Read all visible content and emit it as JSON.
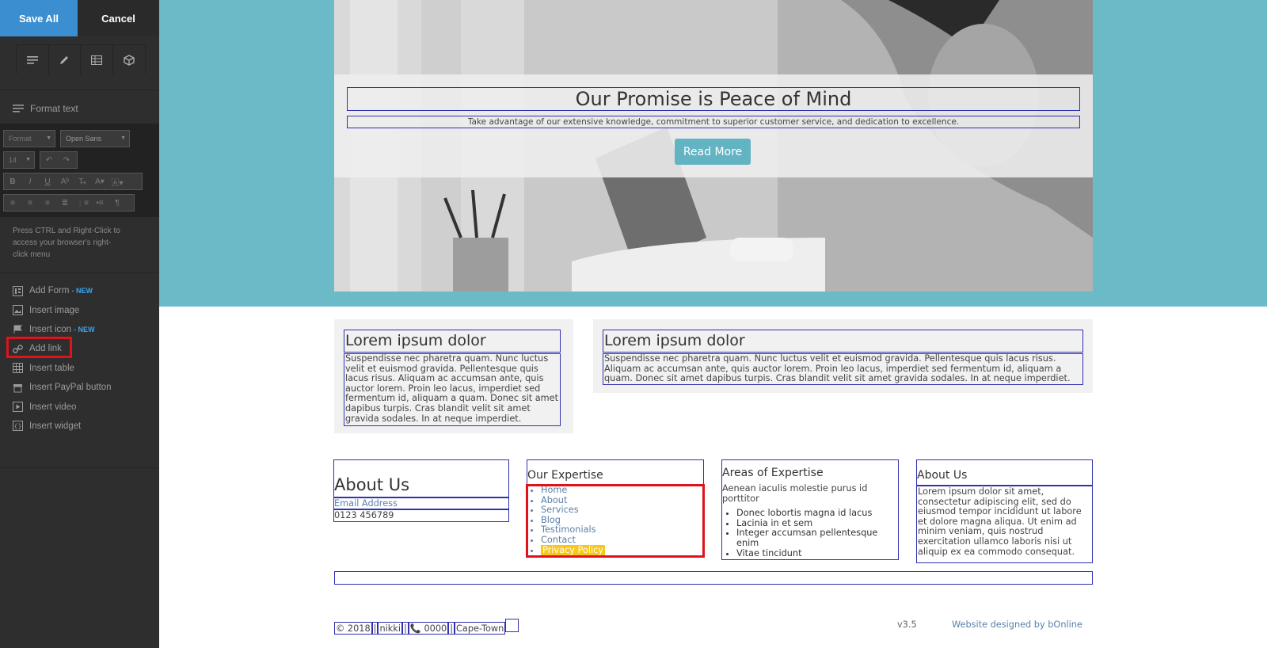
{
  "sidebar": {
    "save_label": "Save All",
    "cancel_label": "Cancel",
    "format_title": "Format text",
    "format_select": "Format",
    "font_select": "Open Sans",
    "size_select": "14",
    "hint": "Press CTRL and Right-Click to access your browser's right-click menu",
    "new_badge": "- NEW",
    "items": [
      {
        "label": "Add Form",
        "icon": "form-icon",
        "new": true
      },
      {
        "label": "Insert image",
        "icon": "image-icon",
        "new": false
      },
      {
        "label": "Insert icon",
        "icon": "flag-icon",
        "new": true
      },
      {
        "label": "Add link",
        "icon": "link-icon",
        "new": false
      },
      {
        "label": "Insert table",
        "icon": "table-icon",
        "new": false
      },
      {
        "label": "Insert PayPal button",
        "icon": "paypal-icon",
        "new": false
      },
      {
        "label": "Insert video",
        "icon": "video-icon",
        "new": false
      },
      {
        "label": "Insert widget",
        "icon": "widget-icon",
        "new": false
      }
    ]
  },
  "hero": {
    "title": "Our Promise is Peace of Mind",
    "subtitle": "Take advantage of our extensive knowledge, commitment to superior customer service, and dedication to excellence.",
    "button": "Read More"
  },
  "cards": [
    {
      "title": "Lorem ipsum dolor",
      "body": "Suspendisse nec pharetra quam. Nunc luctus velit et euismod gravida. Pellentesque quis lacus risus. Aliquam ac accumsan ante, quis auctor lorem. Proin leo lacus, imperdiet sed fermentum id, aliquam a quam. Donec sit amet dapibus turpis. Cras blandit velit sit amet gravida sodales. In at neque imperdiet."
    },
    {
      "title": "Lorem ipsum dolor",
      "body": "Suspendisse nec pharetra quam. Nunc luctus velit et euismod gravida. Pellentesque quis lacus risus. Aliquam ac accumsan ante, quis auctor lorem. Proin leo lacus, imperdiet sed fermentum id, aliquam a quam. Donec sit amet dapibus turpis. Cras blandit velit sit amet gravida sodales. In at neque imperdiet."
    }
  ],
  "footer": {
    "about": {
      "title": "About Us",
      "email": "Email Address",
      "phone": "0123 456789"
    },
    "expertise": {
      "title": "Our Expertise",
      "links": [
        "Home",
        "About",
        "Services",
        "Blog",
        "Testimonials",
        "Contact",
        "Privacy Policy"
      ]
    },
    "areas": {
      "title": "Areas of Expertise",
      "intro": "Aenean iaculis molestie purus id porttitor",
      "items": [
        "Donec lobortis magna id lacus",
        "Lacinia in et sem",
        "Integer accumsan pellentesque enim",
        "Vitae tincidunt"
      ]
    },
    "about2": {
      "title": "About Us",
      "body": "Lorem ipsum dolor sit amet, consectetur adipiscing elit, sed do eiusmod tempor incididunt ut labore et dolore magna aliqua. Ut enim ad minim veniam, quis nostrud exercitation ullamco laboris nisi ut aliquip ex ea commodo consequat."
    },
    "copyright": "© 2018",
    "sep": "|",
    "name": "nikki",
    "phone": "📞 0000",
    "city": "Cape-Town",
    "version": "v3.5",
    "credit": "Website designed by bOnline"
  },
  "colors": {
    "accent": "#3b8fd0",
    "highlight": "#e0131b",
    "hero_band": "#6abac8"
  }
}
